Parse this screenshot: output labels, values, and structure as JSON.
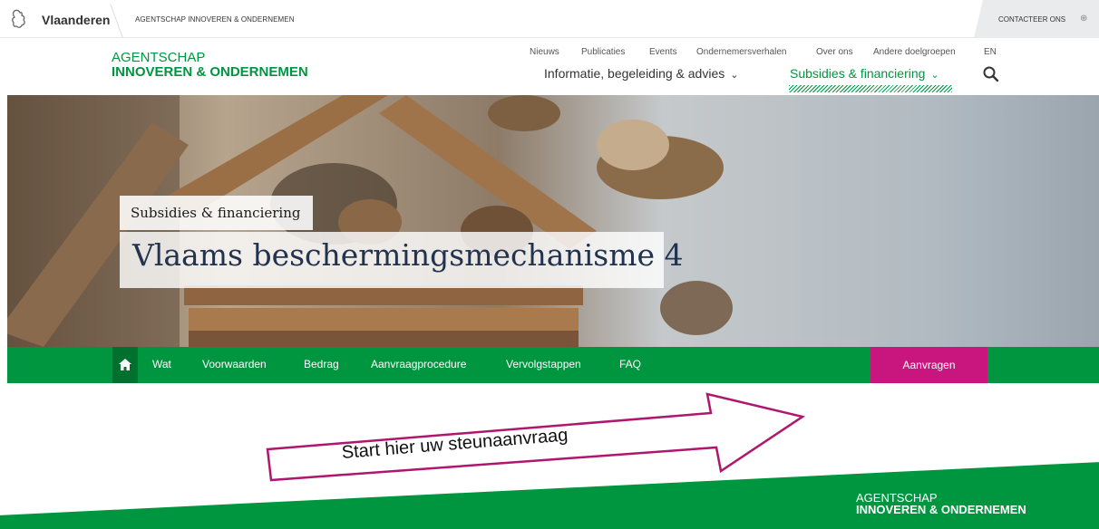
{
  "topbar": {
    "brand": "Vlaanderen",
    "agency": "AGENTSCHAP INNOVEREN & ONDERNEMEN",
    "contact": "CONTACTEER ONS"
  },
  "logo": {
    "line1": "AGENTSCHAP",
    "line2": "INNOVEREN & ONDERNEMEN"
  },
  "secondary_nav": [
    "Nieuws",
    "Publicaties",
    "Events",
    "Ondernemersverhalen",
    "Over ons",
    "Andere doelgroepen",
    "EN"
  ],
  "main_nav": {
    "info": "Informatie, begeleiding & advies",
    "subsidies": "Subsidies & financiering"
  },
  "hero": {
    "breadcrumb": "Subsidies & financiering",
    "title": "Vlaams beschermingsmechanisme 4"
  },
  "page_nav": {
    "items": [
      "Wat",
      "Voorwaarden",
      "Bedrag",
      "Aanvraagprocedure",
      "Vervolgstappen",
      "FAQ"
    ],
    "apply": "Aanvragen"
  },
  "annotation": {
    "text": "Start hier uw steunaanvraag"
  },
  "footer": {
    "line1": "AGENTSCHAP",
    "line2": "INNOVEREN & ONDERNEMEN"
  },
  "colors": {
    "green": "#009640",
    "magenta": "#c8167e",
    "title_blue": "#22334d"
  }
}
